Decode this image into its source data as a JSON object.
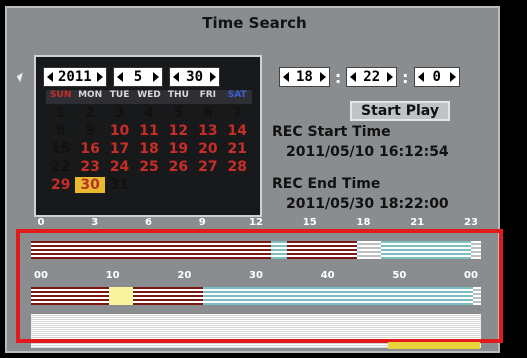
{
  "window": {
    "title": "Time Search"
  },
  "date_selector": {
    "year": "2011",
    "month": "5",
    "day": "30"
  },
  "calendar": {
    "weekdays": [
      "SUN",
      "MON",
      "TUE",
      "WED",
      "THU",
      "FRI",
      "SAT"
    ],
    "weeks": [
      [
        "1",
        "2",
        "3",
        "4",
        "5",
        "6",
        "7"
      ],
      [
        "8",
        "9",
        "10",
        "11",
        "12",
        "13",
        "14"
      ],
      [
        "15",
        "16",
        "17",
        "18",
        "19",
        "20",
        "21"
      ],
      [
        "22",
        "23",
        "24",
        "25",
        "26",
        "27",
        "28"
      ],
      [
        "29",
        "30",
        "31",
        "",
        "",
        "",
        ""
      ]
    ],
    "recorded_days": [
      "10",
      "11",
      "12",
      "13",
      "14",
      "16",
      "17",
      "18",
      "19",
      "20",
      "21",
      "23",
      "24",
      "25",
      "26",
      "27",
      "28",
      "29"
    ],
    "selected_day": "30"
  },
  "time_selector": {
    "hour": "18",
    "minute": "22",
    "second": "0"
  },
  "start_play_label": "Start Play",
  "rec_start": {
    "label": "REC Start Time",
    "value": "2011/05/10 16:12:54"
  },
  "rec_end": {
    "label": "REC End Time",
    "value": "2011/05/30 18:22:00"
  },
  "timeline": {
    "hour_labels": [
      "0",
      "3",
      "6",
      "9",
      "12",
      "15",
      "18",
      "21",
      "23"
    ],
    "minute_labels": [
      "00",
      "10",
      "20",
      "30",
      "40",
      "50",
      "00"
    ]
  },
  "colors": {
    "panel": "#8a8d90",
    "recorded": "#c82d27",
    "selected": "#e9ba2e",
    "highlight": "#e11b1b",
    "cyan_record": "#7bbfc0"
  }
}
